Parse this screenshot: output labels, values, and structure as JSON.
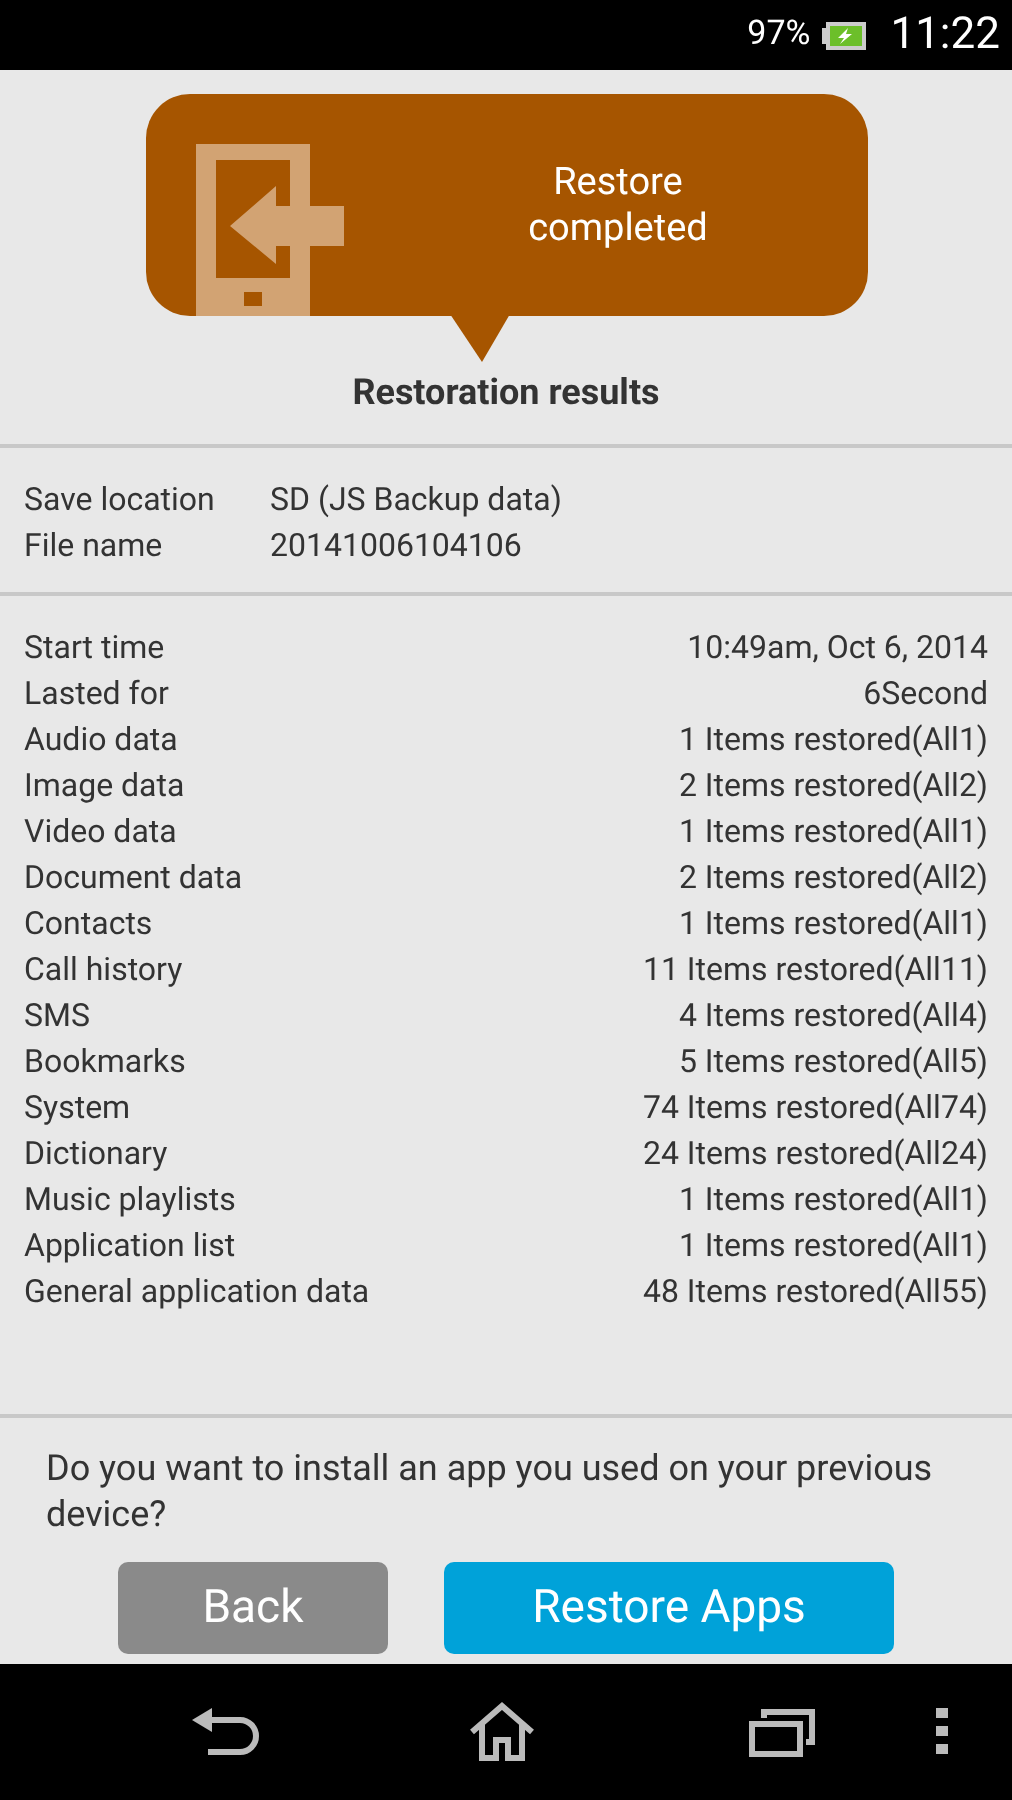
{
  "status_bar": {
    "battery": "97%",
    "time": "11:22"
  },
  "banner": {
    "text": "Restore\ncompleted"
  },
  "title": "Restoration results",
  "file_info": [
    {
      "label": "Save location",
      "value": "SD (JS Backup data)"
    },
    {
      "label": "File name",
      "value": "20141006104106"
    }
  ],
  "results": [
    {
      "label": "Start time",
      "value": "10:49am, Oct 6, 2014"
    },
    {
      "label": "Lasted for",
      "value": "6Second"
    },
    {
      "label": "Audio data",
      "value": "1 Items restored(All1)"
    },
    {
      "label": "Image data",
      "value": "2 Items restored(All2)"
    },
    {
      "label": "Video data",
      "value": "1 Items restored(All1)"
    },
    {
      "label": "Document data",
      "value": "2 Items restored(All2)"
    },
    {
      "label": "Contacts",
      "value": "1 Items restored(All1)"
    },
    {
      "label": "Call history",
      "value": "11 Items restored(All11)"
    },
    {
      "label": "SMS",
      "value": "4 Items restored(All4)"
    },
    {
      "label": "Bookmarks",
      "value": "5 Items restored(All5)"
    },
    {
      "label": "System",
      "value": "74 Items restored(All74)"
    },
    {
      "label": "Dictionary",
      "value": "24 Items restored(All24)"
    },
    {
      "label": "Music playlists",
      "value": "1 Items restored(All1)"
    },
    {
      "label": "Application list",
      "value": "1 Items restored(All1)"
    },
    {
      "label": "General application data",
      "value": "48 Items restored(All55)"
    }
  ],
  "question": "Do you want to install an app you used on your previous device?",
  "buttons": [
    {
      "label": "Back",
      "kind": "secondary"
    },
    {
      "label": "Restore Apps",
      "kind": "primary"
    }
  ]
}
